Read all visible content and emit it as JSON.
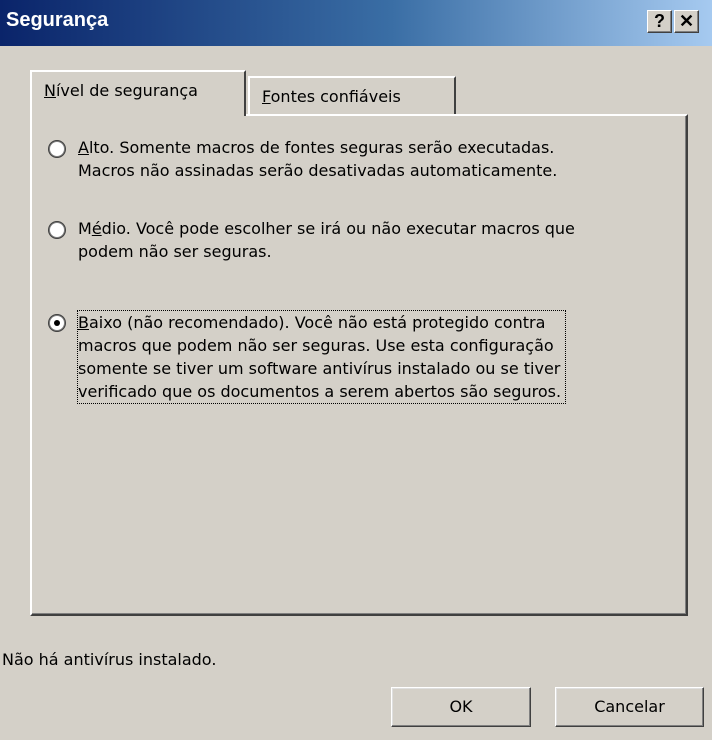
{
  "window": {
    "title": "Segurança",
    "help_button": "?",
    "close_button": "✕"
  },
  "tabs": [
    {
      "label": "Nível de segurança",
      "accel": "N",
      "rest": "ível de segurança",
      "selected": true
    },
    {
      "label": "Fontes confiáveis",
      "accel": "F",
      "rest": "ontes confiáveis",
      "selected": false
    }
  ],
  "security_levels": [
    {
      "accel": "A",
      "line1_rest": "lto. Somente macros de fontes seguras serão executadas.",
      "line2": "Macros não assinadas serão desativadas automaticamente.",
      "selected": false
    },
    {
      "pre": "M",
      "accel": "é",
      "line1_rest": "dio. Você pode escolher se irá ou não executar macros que",
      "line2": "podem não ser seguras.",
      "selected": false
    },
    {
      "accel": "B",
      "line1_rest": "aixo (não recomendado). Você não está protegido contra",
      "line2": "macros que podem não ser seguras. Use esta configuração",
      "line3": "somente se tiver um software antivírus instalado ou se tiver",
      "line4": "verificado que os documentos a serem abertos são seguros.",
      "selected": true
    }
  ],
  "status_text": "Não há antivírus instalado.",
  "buttons": {
    "ok": "OK",
    "cancel": "Cancelar"
  }
}
